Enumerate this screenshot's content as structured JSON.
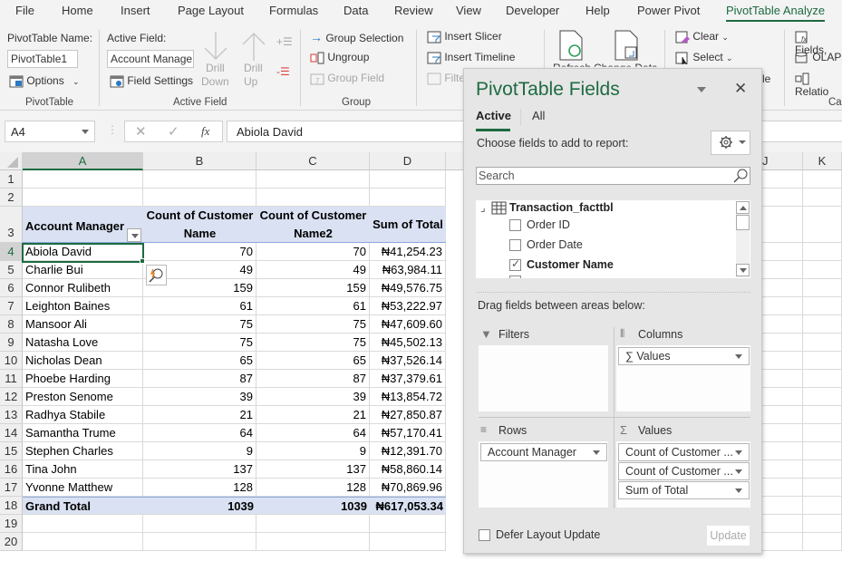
{
  "menu_tabs": [
    "File",
    "Home",
    "Insert",
    "Page Layout",
    "Formulas",
    "Data",
    "Review",
    "View",
    "Developer",
    "Help",
    "Power Pivot",
    "PivotTable Analyze"
  ],
  "active_tab": "PivotTable Analyze",
  "ribbon": {
    "pivottable_group": {
      "name_label": "PivotTable Name:",
      "name_value": "PivotTable1",
      "options_label": "Options",
      "group_label": "PivotTable"
    },
    "active_field_group": {
      "label": "Active Field:",
      "value": "Account Manage",
      "field_settings": "Field Settings",
      "drill_down": [
        "Drill",
        "Down"
      ],
      "drill_up": [
        "Drill",
        "Up"
      ],
      "group_label": "Active Field"
    },
    "group_group": {
      "group_selection": "Group Selection",
      "ungroup": "Ungroup",
      "group_field": "Group Field",
      "group_label": "Group"
    },
    "filter_group": {
      "insert_slicer": "Insert Slicer",
      "insert_timeline": "Insert Timeline",
      "filter_connections": "Filte"
    },
    "data_group": {
      "refresh": "Refresh",
      "change_data": "Change Data"
    },
    "actions_group": {
      "clear": "Clear",
      "select": "Select",
      "move_partial": "le"
    },
    "calc_group": {
      "fields": "Fields,",
      "olap": "OLAP",
      "relationships": "Relatio",
      "group_label_partial": "Cal"
    }
  },
  "formula_bar": {
    "name_box": "A4",
    "formula": "Abiola David",
    "fx": "fx"
  },
  "columns": [
    "A",
    "B",
    "C",
    "D",
    "J",
    "K"
  ],
  "rows": [
    "1",
    "2",
    "3",
    "4",
    "5",
    "6",
    "7",
    "8",
    "9",
    "10",
    "11",
    "12",
    "13",
    "14",
    "15",
    "16",
    "17",
    "18",
    "19",
    "20"
  ],
  "pivot": {
    "headers": [
      "Account Manager",
      "Count of Customer Name",
      "Count of Customer Name2",
      "Sum of Total"
    ],
    "header_lines": {
      "b1": "Count of Customer",
      "b2": "Name",
      "c1": "Count of Customer",
      "c2": "Name2"
    },
    "records": [
      {
        "manager": "Abiola David",
        "count1": "70",
        "count2": "70",
        "total": "₦41,254.23"
      },
      {
        "manager": "Charlie Bui",
        "count1": "49",
        "count2": "49",
        "total": "₦63,984.11"
      },
      {
        "manager": "Connor Rulibeth",
        "count1": "159",
        "count2": "159",
        "total": "₦49,576.75"
      },
      {
        "manager": "Leighton Baines",
        "count1": "61",
        "count2": "61",
        "total": "₦53,222.97"
      },
      {
        "manager": "Mansoor Ali",
        "count1": "75",
        "count2": "75",
        "total": "₦47,609.60"
      },
      {
        "manager": "Natasha Love",
        "count1": "75",
        "count2": "75",
        "total": "₦45,502.13"
      },
      {
        "manager": "Nicholas Dean",
        "count1": "65",
        "count2": "65",
        "total": "₦37,526.14"
      },
      {
        "manager": "Phoebe Harding",
        "count1": "87",
        "count2": "87",
        "total": "₦37,379.61"
      },
      {
        "manager": "Preston Senome",
        "count1": "39",
        "count2": "39",
        "total": "₦13,854.72"
      },
      {
        "manager": "Radhya Stabile",
        "count1": "21",
        "count2": "21",
        "total": "₦27,850.87"
      },
      {
        "manager": "Samantha Trume",
        "count1": "64",
        "count2": "64",
        "total": "₦57,170.41"
      },
      {
        "manager": "Stephen Charles",
        "count1": "9",
        "count2": "9",
        "total": "₦12,391.70"
      },
      {
        "manager": "Tina John",
        "count1": "137",
        "count2": "137",
        "total": "₦58,860.14"
      },
      {
        "manager": "Yvonne Matthew",
        "count1": "128",
        "count2": "128",
        "total": "₦70,869.96"
      }
    ],
    "grand_total": {
      "label": "Grand Total",
      "count1": "1039",
      "count2": "1039",
      "total": "₦617,053.34"
    }
  },
  "field_pane": {
    "title": "PivotTable Fields",
    "tabs": [
      "Active",
      "All"
    ],
    "active_tab": "Active",
    "choose_label": "Choose fields to add to report:",
    "search_placeholder": "Search",
    "table_name": "Transaction_facttbl",
    "fields": [
      {
        "name": "Order ID",
        "checked": false
      },
      {
        "name": "Order Date",
        "checked": false
      },
      {
        "name": "Customer Name",
        "checked": true
      }
    ],
    "drag_label": "Drag fields between areas below:",
    "areas": {
      "filters": {
        "label": "Filters",
        "items": []
      },
      "columns": {
        "label": "Columns",
        "items": [
          "Values"
        ]
      },
      "rows": {
        "label": "Rows",
        "items": [
          "Account Manager"
        ]
      },
      "values": {
        "label": "Values",
        "items": [
          "Count of Customer ...",
          "Count of Customer ...",
          "Sum of Total"
        ]
      }
    },
    "defer_label": "Defer Layout Update",
    "defer_checked": false,
    "update_label": "Update"
  },
  "colors": {
    "accent": "#1e6b41",
    "pivot_header": "#d9e1f2",
    "pane_title": "#1e6b41"
  }
}
